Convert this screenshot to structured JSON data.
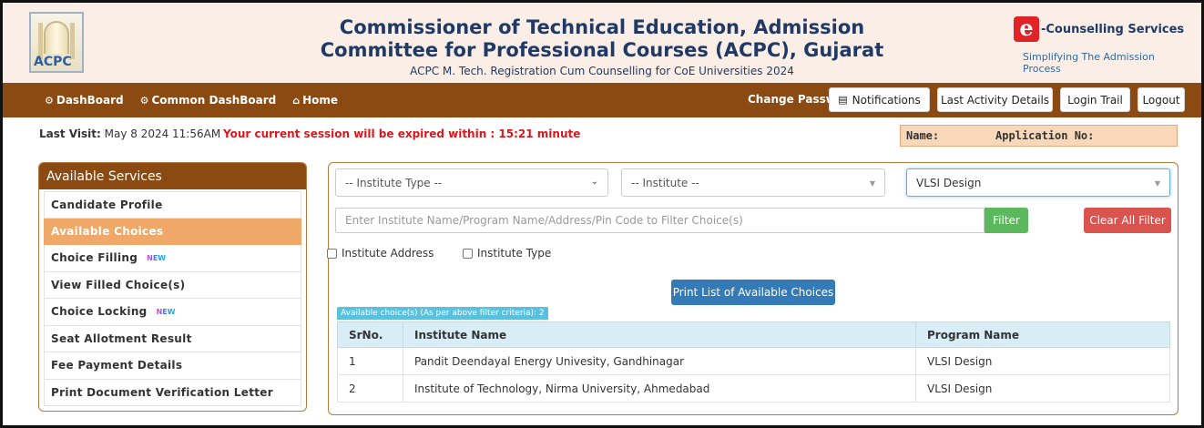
{
  "header": {
    "logo_text": "ACPC",
    "title_line1": "Commissioner of Technical Education, Admission",
    "title_line2": "Committee for Professional Courses (ACPC), Gujarat",
    "subtitle": "ACPC M. Tech. Registration Cum Counselling for CoE Universities 2024",
    "ecs_logo_char": "e",
    "ecs_label": "-Counselling Services",
    "ecs_tagline": "Simplifying The Admission Process"
  },
  "nav": {
    "dashboard": "DashBoard",
    "common_dashboard": "Common DashBoard",
    "home": "Home",
    "change_password": "Change Password",
    "notifications": "Notifications",
    "last_activity": "Last Activity Details",
    "login_trail": "Login Trail",
    "logout": "Logout"
  },
  "status": {
    "last_visit_label": "Last Visit:",
    "last_visit_value": "May 8 2024 11:56AM",
    "session_message": "Your current session will be expired within : 15:21 minute",
    "name_label": "Name:",
    "application_label": "Application No:"
  },
  "sidebar": {
    "title": "Available Services",
    "new_tag": "NEW",
    "items": [
      {
        "label": "Candidate Profile"
      },
      {
        "label": "Available Choices"
      },
      {
        "label": "Choice Filling"
      },
      {
        "label": "View Filled Choice(s)"
      },
      {
        "label": "Choice Locking"
      },
      {
        "label": "Seat Allotment Result"
      },
      {
        "label": "Fee Payment Details"
      },
      {
        "label": "Print Document Verification Letter"
      }
    ]
  },
  "filters": {
    "institute_type": "-- Institute Type --",
    "institute": "-- Institute --",
    "program": "VLSI Design",
    "search_placeholder": "Enter Institute Name/Program Name/Address/Pin Code to Filter Choice(s)",
    "filter_button": "Filter",
    "clear_button": "Clear All Filter",
    "chk_address": "Institute Address",
    "chk_type": "Institute Type",
    "print_button": "Print List of Available Choices",
    "available_badge": "Available choice(s) (As per above filter criteria): 2"
  },
  "table": {
    "headers": [
      "SrNo.",
      "Institute Name",
      "Program Name"
    ],
    "rows": [
      [
        "1",
        "Pandit Deendayal Energy Univesity, Gandhinagar",
        "VLSI Design"
      ],
      [
        "2",
        "Institute of Technology, Nirma University, Ahmedabad",
        "VLSI Design"
      ]
    ]
  }
}
